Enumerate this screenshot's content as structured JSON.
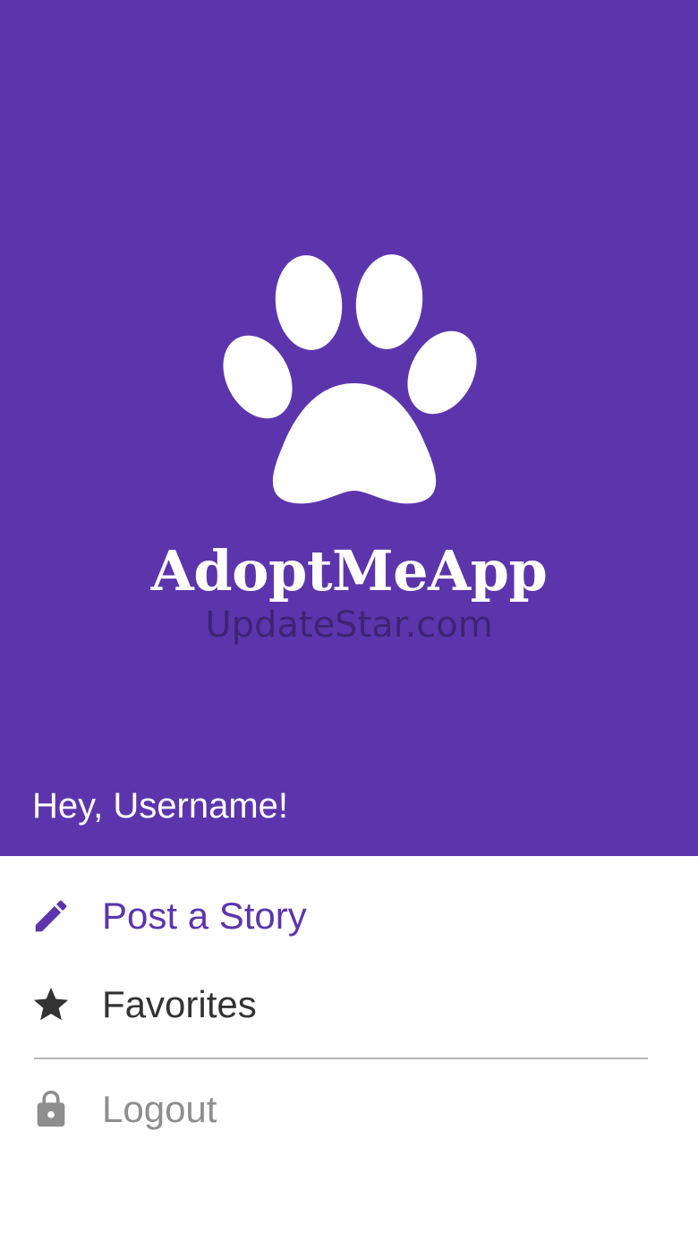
{
  "header": {
    "app_name": "AdoptMeApp",
    "watermark": "UpdateStar.com",
    "greeting": "Hey, Username!",
    "logo_icon": "paw-print-icon",
    "background_color": "#5c35ad"
  },
  "menu": {
    "items": [
      {
        "label": "Post a Story",
        "icon": "pencil-icon",
        "color": "#5c35ad",
        "active": true
      },
      {
        "label": "Favorites",
        "icon": "star-icon",
        "color": "#333333",
        "active": false
      }
    ],
    "secondary_items": [
      {
        "label": "Logout",
        "icon": "lock-icon",
        "color": "#8e8e8e"
      }
    ]
  }
}
